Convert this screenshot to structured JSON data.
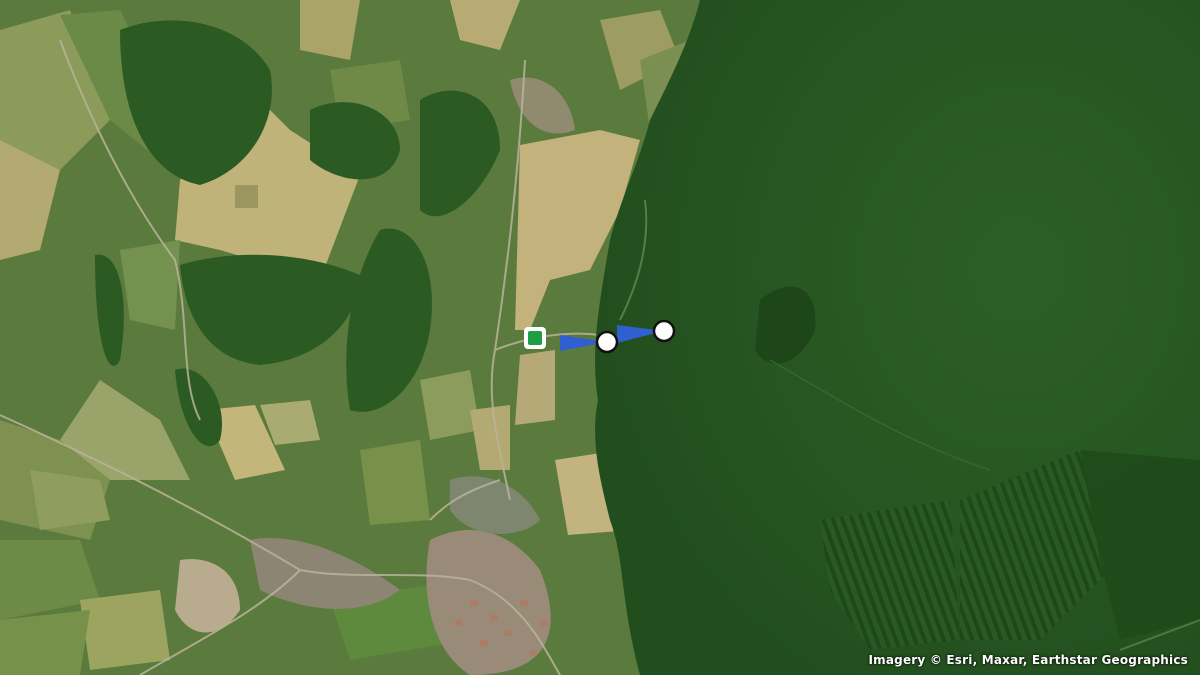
{
  "map": {
    "basemap": "satellite imagery",
    "attribution": "Imagery © Esri, Maxar, Earthstar Geographics"
  },
  "markers": [
    {
      "kind": "start-marker",
      "shape": "rounded square",
      "color": "#1e9e45"
    },
    {
      "kind": "waypoint",
      "shape": "circle",
      "color": "#ffffff"
    },
    {
      "kind": "waypoint",
      "shape": "circle",
      "color": "#ffffff"
    }
  ],
  "route": {
    "color": "#2f5fd0",
    "segments": 2
  }
}
